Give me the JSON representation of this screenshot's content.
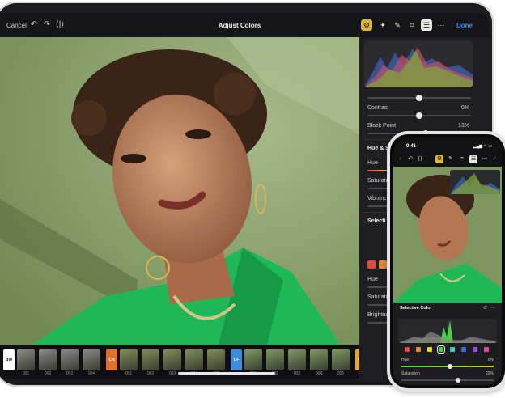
{
  "ipad": {
    "toolbar": {
      "cancel_label": "Cancel",
      "undo_icon": "undo-icon",
      "redo_icon": "redo-icon",
      "compare_icon": "compare-icon",
      "title": "Adjust Colors",
      "done_label": "Done",
      "tools": [
        "adjust-icon",
        "magic-icon",
        "brush-icon",
        "crop-icon",
        "layers-icon",
        "more-icon"
      ],
      "accent": "#d9b53a",
      "done_color": "#3b8cff"
    },
    "panel": {
      "contrast_label": "Contrast",
      "contrast_value": "0%",
      "contrast_level": 0.5,
      "black_point_label": "Black Point",
      "black_point_value": "13%",
      "black_point_level": 0.56,
      "hue_sat_title": "Hue & Satu",
      "hue_label": "Hue",
      "saturation_label": "Saturation",
      "vibrance_label": "Vibranc",
      "selective_title": "Selecti",
      "hue2_label": "Hue",
      "saturation2_label": "Saturation",
      "brightness_label": "Brightne"
    },
    "filters": {
      "chips": [
        {
          "label": "BW",
          "color": "#ffffff",
          "text_color": "#111111"
        },
        {
          "label": "CN",
          "color": "#e0702a",
          "text_color": "#ffffff"
        },
        {
          "label": "CF",
          "color": "#3b8cdb",
          "text_color": "#ffffff"
        },
        {
          "label": "MF",
          "color": "#e5a43a",
          "text_color": "#ffffff"
        }
      ],
      "bw_labels": [
        "001",
        "002",
        "003",
        "004"
      ],
      "cn_labels": [
        "001",
        "002",
        "003",
        "004",
        "005"
      ],
      "cf_labels": [
        "001",
        "002",
        "003",
        "004",
        "005"
      ],
      "mf_labels": [
        "001"
      ]
    }
  },
  "iphone": {
    "time": "9:41",
    "panel_title": "Selective Color",
    "hue_label": "Hue",
    "hue_value": "6%",
    "hue_level": 0.53,
    "saturation_label": "Saturation",
    "saturation_value": "22%",
    "saturation_level": 0.61,
    "swatches": [
      "#e04a3a",
      "#e08a3a",
      "#e0d23a",
      "#4ad04a",
      "#3ad0d0",
      "#3a6ae0",
      "#9a4ae0",
      "#e04ab0"
    ],
    "selected_swatch": 3
  }
}
